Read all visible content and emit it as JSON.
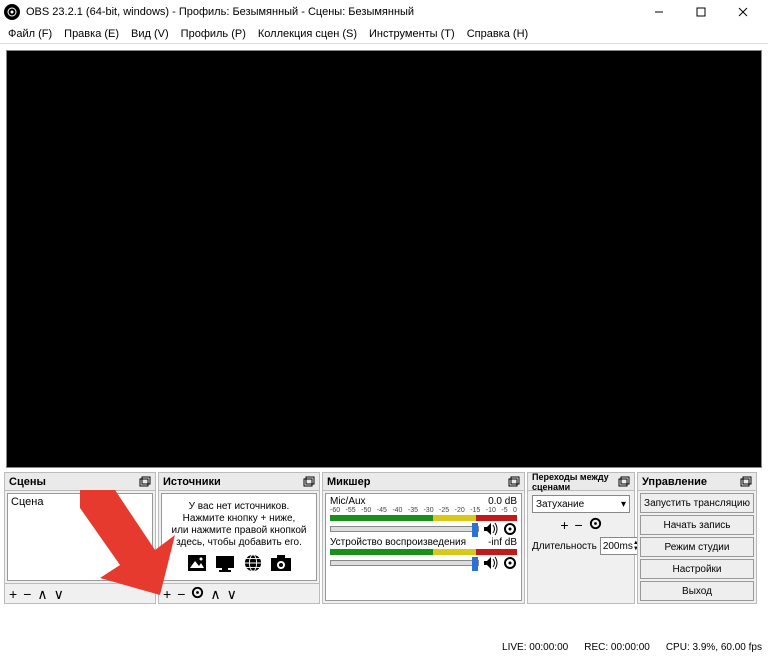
{
  "title": "OBS 23.2.1 (64-bit, windows) - Профиль: Безымянный - Сцены: Безымянный",
  "menu": {
    "file": "Файл (F)",
    "edit": "Правка (E)",
    "view": "Вид (V)",
    "profile": "Профиль (P)",
    "scenes": "Коллекция сцен (S)",
    "tools": "Инструменты (T)",
    "help": "Справка (H)"
  },
  "panels": {
    "scenes": {
      "title": "Сцены",
      "item": "Сцена"
    },
    "sources": {
      "title": "Источники",
      "empty_l1": "У вас нет источников.",
      "empty_l2": "Нажмите кнопку + ниже,",
      "empty_l3": "или нажмите правой кнопкой",
      "empty_l4": "здесь, чтобы добавить его."
    },
    "mixer": {
      "title": "Микшер",
      "ch1": {
        "name": "Mic/Aux",
        "db": "0.0 dB"
      },
      "ch2": {
        "name": "Устройство воспроизведения",
        "db": "-inf dB"
      },
      "scale": [
        "-60",
        "-55",
        "-50",
        "-45",
        "-40",
        "-35",
        "-30",
        "-25",
        "-20",
        "-15",
        "-10",
        "-5",
        "0"
      ]
    },
    "transitions": {
      "title": "Переходы между сценами",
      "fade": "Затухание",
      "duration_label": "Длительность",
      "duration_value": "200ms"
    },
    "controls": {
      "title": "Управление",
      "start_stream": "Запустить трансляцию",
      "start_record": "Начать запись",
      "studio": "Режим студии",
      "settings": "Настройки",
      "exit": "Выход"
    }
  },
  "status": {
    "live": "LIVE: 00:00:00",
    "rec": "REC: 00:00:00",
    "cpu": "CPU: 3.9%, 60.00 fps"
  }
}
